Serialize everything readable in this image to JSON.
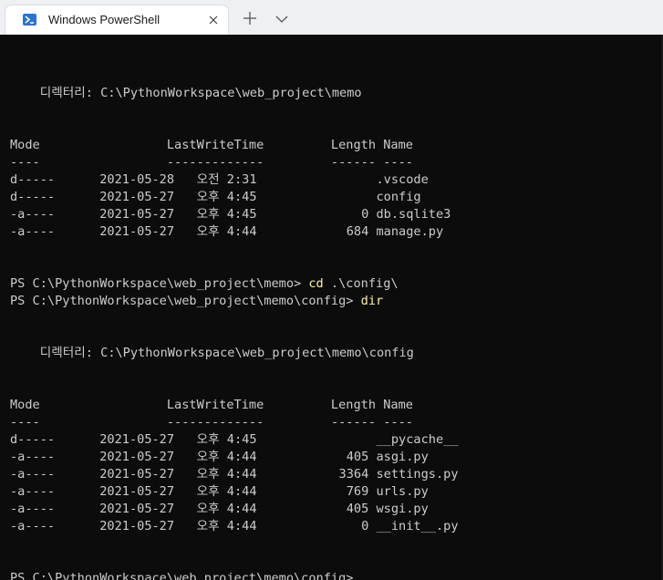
{
  "tab": {
    "title": "Windows PowerShell",
    "icon": "powershell-icon",
    "close_icon": "close-icon",
    "new_tab_icon": "plus-icon",
    "dropdown_icon": "chevron-down-icon"
  },
  "colors": {
    "terminal_bg": "#0c0c0c",
    "terminal_fg": "#cccccc",
    "command_fg": "#f9f1a5",
    "tabbar_bg": "#eff0f3",
    "tab_bg": "#ffffff",
    "powershell_blue": "#2a73d6"
  },
  "terminal": {
    "lines": [
      {
        "text": ""
      },
      {
        "text": ""
      },
      {
        "text": "    디렉터리: C:\\PythonWorkspace\\web_project\\memo"
      },
      {
        "text": ""
      },
      {
        "text": ""
      },
      {
        "text": "Mode                 LastWriteTime         Length Name"
      },
      {
        "text": "----                 -------------         ------ ----"
      },
      {
        "text": "d-----      2021-05-28   오전 2:31                .vscode"
      },
      {
        "text": "d-----      2021-05-27   오후 4:45                config"
      },
      {
        "text": "-a----      2021-05-27   오후 4:45              0 db.sqlite3"
      },
      {
        "text": "-a----      2021-05-27   오후 4:44            684 manage.py"
      },
      {
        "text": ""
      },
      {
        "text": ""
      },
      {
        "text": "PS C:\\PythonWorkspace\\web_project\\memo> ",
        "cmd": "cd",
        "rest": " .\\config\\"
      },
      {
        "text": "PS C:\\PythonWorkspace\\web_project\\memo\\config> ",
        "cmd": "dir",
        "rest": ""
      },
      {
        "text": ""
      },
      {
        "text": ""
      },
      {
        "text": "    디렉터리: C:\\PythonWorkspace\\web_project\\memo\\config"
      },
      {
        "text": ""
      },
      {
        "text": ""
      },
      {
        "text": "Mode                 LastWriteTime         Length Name"
      },
      {
        "text": "----                 -------------         ------ ----"
      },
      {
        "text": "d-----      2021-05-27   오후 4:45                __pycache__"
      },
      {
        "text": "-a----      2021-05-27   오후 4:44            405 asgi.py"
      },
      {
        "text": "-a----      2021-05-27   오후 4:44           3364 settings.py"
      },
      {
        "text": "-a----      2021-05-27   오후 4:44            769 urls.py"
      },
      {
        "text": "-a----      2021-05-27   오후 4:44            405 wsgi.py"
      },
      {
        "text": "-a----      2021-05-27   오후 4:44              0 __init__.py"
      },
      {
        "text": ""
      },
      {
        "text": ""
      },
      {
        "text": "PS C:\\PythonWorkspace\\web_project\\memo\\config> "
      }
    ]
  }
}
